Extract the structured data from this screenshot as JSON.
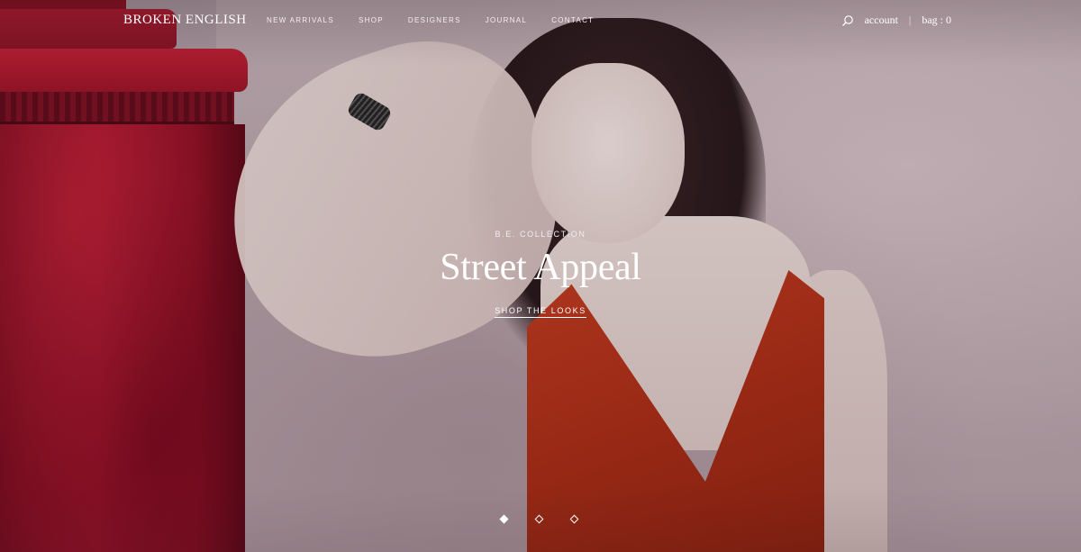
{
  "brand": {
    "logo": "BROKEN ENGLISH"
  },
  "nav": {
    "items": [
      {
        "label": "NEW ARRIVALS"
      },
      {
        "label": "SHOP"
      },
      {
        "label": "DESIGNERS"
      },
      {
        "label": "JOURNAL"
      },
      {
        "label": "CONTACT"
      }
    ],
    "account_label": "account",
    "separator": "|",
    "bag_label": "bag : 0",
    "search_icon": "search-icon"
  },
  "hero": {
    "kicker": "B.E. COLLECTION",
    "headline": "Street Appeal",
    "cta_label": "SHOP THE LOOKS"
  },
  "slider": {
    "dot_count": 3,
    "active_index": 0
  },
  "colors": {
    "pillar_red": "#a3132b",
    "dress_red": "#c03a1e",
    "wall_mauve": "#b9a6ad",
    "text": "#ffffff"
  }
}
